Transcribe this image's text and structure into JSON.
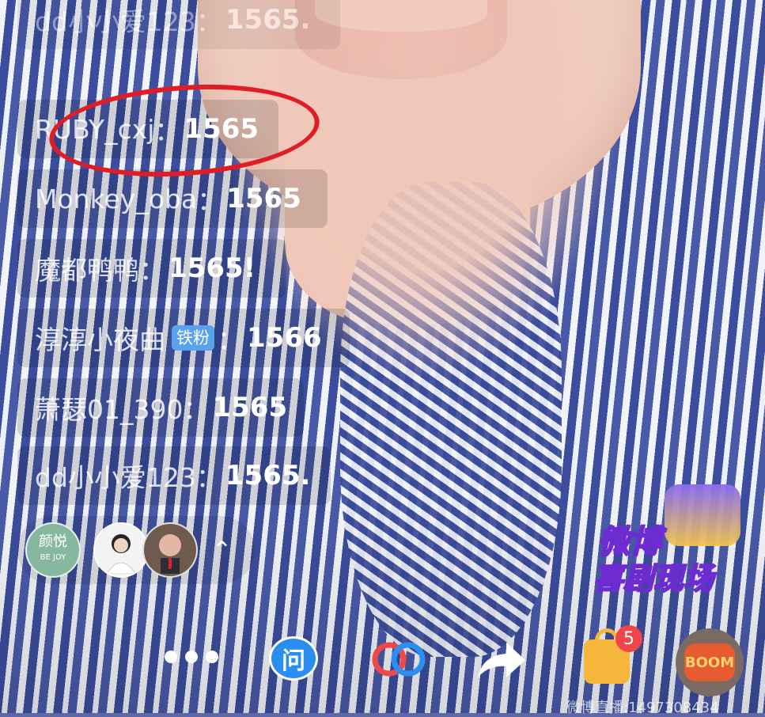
{
  "comments": [
    {
      "user": "dd小小爱123",
      "sep": "：",
      "msg": "1565.",
      "badge": ""
    },
    {
      "user": "RUBY_cxj",
      "sep": "：",
      "msg": "1565",
      "badge": ""
    },
    {
      "user": "Monkey_oba",
      "sep": "：",
      "msg": "1565",
      "badge": ""
    },
    {
      "user": "魔都鸭鸭",
      "sep": "：",
      "msg": "1565!",
      "badge": ""
    },
    {
      "user": "淳淳小夜曲",
      "sep": "：",
      "msg": "1566",
      "badge": "铁粉"
    },
    {
      "user": "萧瑟01_390",
      "sep": "：",
      "msg": "1565",
      "badge": ""
    },
    {
      "user": "dd小小爱123",
      "sep": "：",
      "msg": "1565.",
      "badge": ""
    }
  ],
  "viewers": {
    "first_label_top": "颜悦",
    "first_label_bottom": "BE JOY",
    "expand_icon": "chevron-up-icon"
  },
  "brand": {
    "line1": "微博",
    "line2": "喜剧现场"
  },
  "bottom_bar": {
    "more_icon": "more-dots-icon",
    "ask_label": "问",
    "connect_icon": "link-icon",
    "share_icon": "share-arrow-icon",
    "shop_icon": "shopping-bag-icon",
    "shop_count": "5",
    "gift_label": "BOOM",
    "live_id": "微博直播:1497308434"
  },
  "colors": {
    "highlight_circle": "#e21c24",
    "badge": "#5aa2ee",
    "ask": "#2a8df0",
    "shop": "#f6b63b"
  }
}
